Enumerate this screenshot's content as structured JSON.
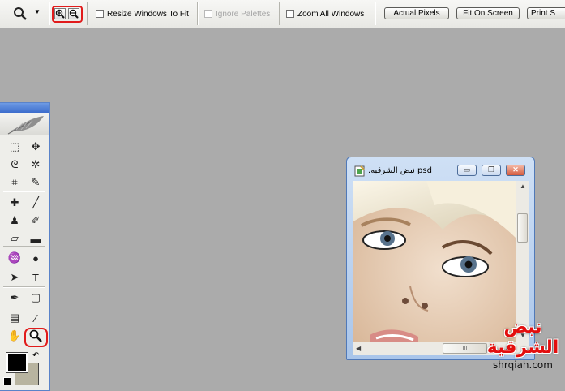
{
  "options_bar": {
    "tool_icon": "zoom-tool-icon",
    "zoom_in_icon": "zoom-in-icon",
    "zoom_out_icon": "zoom-out-icon",
    "resize_windows_label": "Resize Windows To Fit",
    "resize_windows_checked": false,
    "ignore_palettes_label": "Ignore Palettes",
    "ignore_palettes_enabled": false,
    "zoom_all_windows_label": "Zoom All Windows",
    "zoom_all_windows_checked": false,
    "actual_pixels_label": "Actual Pixels",
    "fit_on_screen_label": "Fit On Screen",
    "print_size_label": "Print S"
  },
  "tools": [
    "marquee-tool-icon",
    "move-tool-icon",
    "lasso-tool-icon",
    "magic-wand-tool-icon",
    "crop-tool-icon",
    "slice-tool-icon",
    "healing-brush-tool-icon",
    "brush-tool-icon",
    "clone-stamp-tool-icon",
    "history-brush-tool-icon",
    "eraser-tool-icon",
    "gradient-tool-icon",
    "blur-tool-icon",
    "dodge-tool-icon",
    "path-selection-tool-icon",
    "type-tool-icon",
    "pen-tool-icon",
    "shape-tool-icon",
    "notes-tool-icon",
    "eyedropper-tool-icon",
    "hand-tool-icon",
    "zoom-tool-icon"
  ],
  "colors": {
    "foreground": "#000000",
    "background": "#b8b4a0",
    "highlight": "#e11b1b",
    "workspace": "#ababab"
  },
  "document": {
    "title": ".نبض الشرقيه psd",
    "minimize_symbol": "▭",
    "restore_symbol": "❐",
    "close_symbol": "✕",
    "hscroll_grip": "III"
  },
  "watermark": {
    "line1": "نبض",
    "line2": "الشرقية",
    "url": "shrqiah.com"
  }
}
